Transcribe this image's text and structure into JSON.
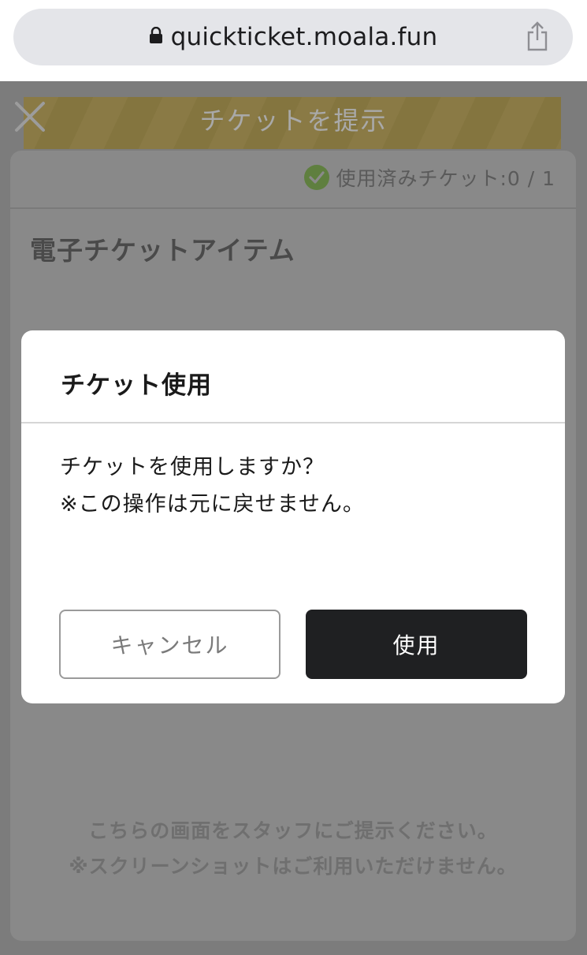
{
  "browser": {
    "url": "quickticket.moala.fun",
    "icons": [
      "lock-icon",
      "share-icon"
    ]
  },
  "page": {
    "title": "チケットを提示",
    "close_icon": "close-icon",
    "used_status": "使用済みチケット:0 / 1",
    "item_heading": "電子チケットアイテム",
    "instructions": [
      "こちらの画面をスタッフにご提示ください。",
      "※スクリーンショットはご利用いただけません。"
    ]
  },
  "modal": {
    "title": "チケット使用",
    "message_lines": [
      "チケットを使用しますか？",
      "※この操作は元に戻せません。"
    ],
    "cancel_label": "キャンセル",
    "use_label": "使用"
  },
  "colors": {
    "overlay_page": "#7c7c7c",
    "card": "#898989",
    "primary_button": "#1f2022",
    "check_green": "#5f7f3f"
  }
}
